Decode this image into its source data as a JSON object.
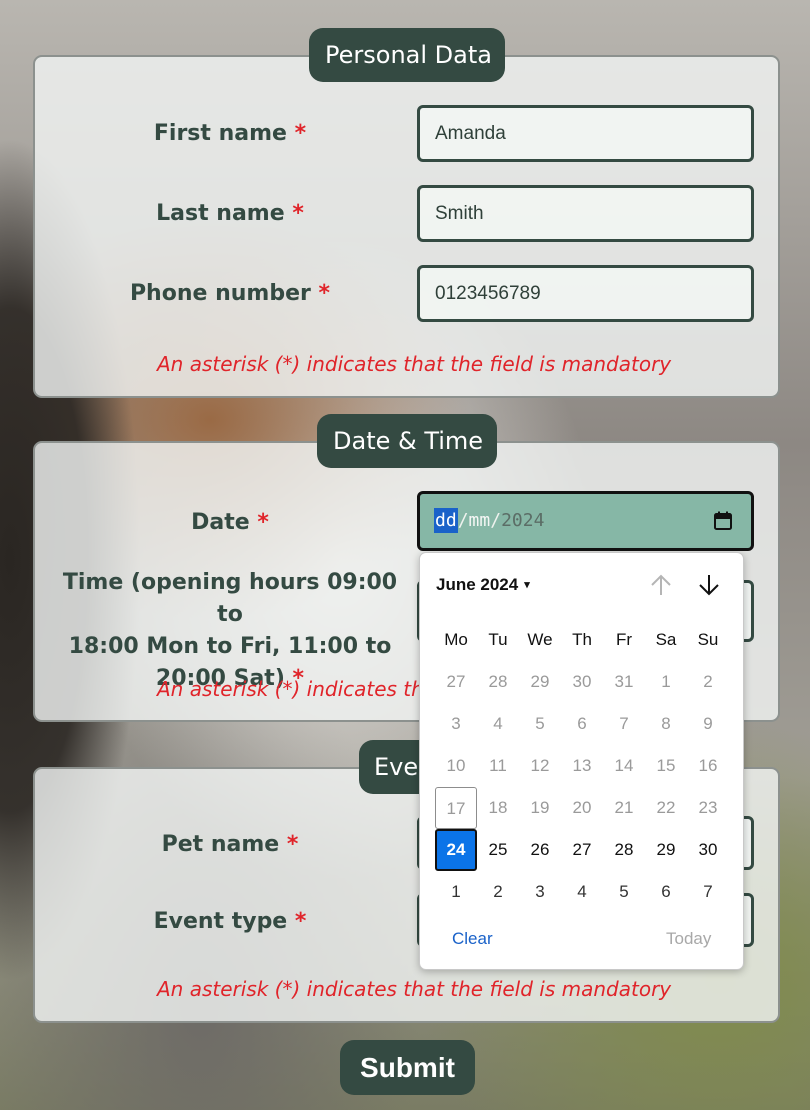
{
  "personal": {
    "legend": "Personal Data",
    "first_name_label": "First name",
    "last_name_label": "Last name",
    "phone_label": "Phone number",
    "asterisk": "*",
    "first_name_value": "Amanda",
    "last_name_value": "Smith",
    "phone_value": "0123456789",
    "note": "An asterisk (*) indicates that the field is mandatory"
  },
  "datetime": {
    "legend": "Date & Time",
    "date_label": "Date",
    "time_label_line1": "Time (opening hours 09:00 to",
    "time_label_line2": "18:00 Mon to Fri, 11:00 to",
    "time_label_line3": "20:00 Sat)",
    "asterisk": "*",
    "date_input": {
      "day": "dd",
      "sep1": "/",
      "month": "mm",
      "sep2": "/",
      "year": "2024"
    },
    "note": "An asterisk (*) indicates the"
  },
  "event": {
    "legend_partial": "Eve",
    "pet_name_label": "Pet name",
    "event_type_label": "Event type",
    "asterisk": "*",
    "note": "An asterisk (*) indicates that the field is mandatory"
  },
  "datepicker": {
    "month_year": "June 2024",
    "caret": "▾",
    "prev_icon": "arrow-up-icon",
    "next_icon": "arrow-down-icon",
    "weekdays": [
      "Mo",
      "Tu",
      "We",
      "Th",
      "Fr",
      "Sa",
      "Su"
    ],
    "weeks": [
      [
        "27",
        "28",
        "29",
        "30",
        "31",
        "1",
        "2"
      ],
      [
        "3",
        "4",
        "5",
        "6",
        "7",
        "8",
        "9"
      ],
      [
        "10",
        "11",
        "12",
        "13",
        "14",
        "15",
        "16"
      ],
      [
        "17",
        "18",
        "19",
        "20",
        "21",
        "22",
        "23"
      ],
      [
        "24",
        "25",
        "26",
        "27",
        "28",
        "29",
        "30"
      ],
      [
        "1",
        "2",
        "3",
        "4",
        "5",
        "6",
        "7"
      ]
    ],
    "selected": "24",
    "today": "17",
    "clear_label": "Clear",
    "today_label": "Today",
    "colors": {
      "selected": "#0b74e8",
      "link": "#1a62c9",
      "muted": "#9a9a9a"
    }
  },
  "submit_label": "Submit",
  "colors": {
    "primary": "#344a42",
    "required": "#e0242a",
    "date_field_bg": "#86b7a6"
  }
}
